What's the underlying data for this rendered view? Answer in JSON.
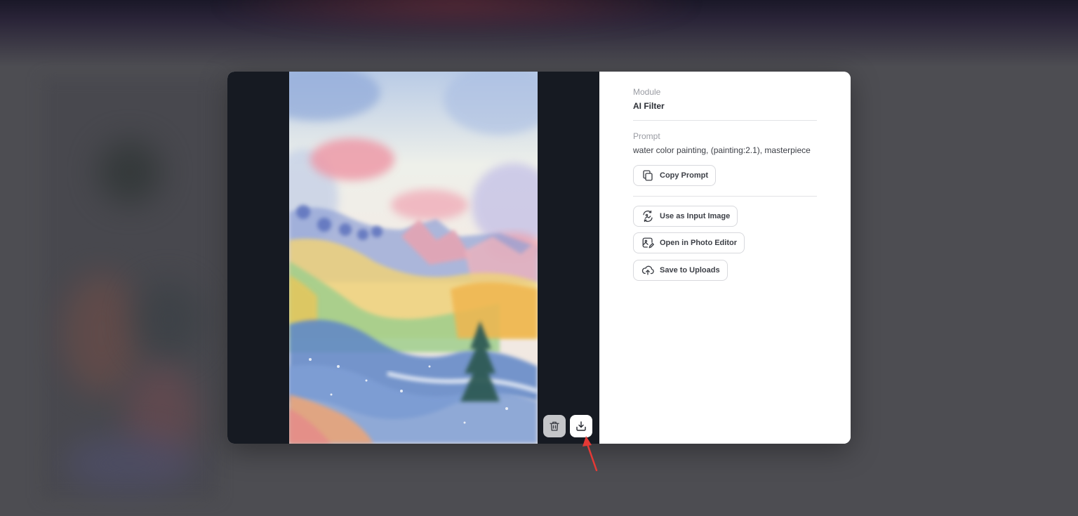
{
  "modal": {
    "module_label": "Module",
    "module_value": "AI Filter",
    "prompt_label": "Prompt",
    "prompt_value": "water color painting, (painting:2.1), masterpiece",
    "copy_prompt": "Copy Prompt",
    "use_as_input": "Use as Input Image",
    "open_editor": "Open in Photo Editor",
    "save_uploads": "Save to Uploads"
  },
  "icons": {
    "delete": "trash-icon",
    "download": "download-icon",
    "copy": "copy-icon",
    "use_input": "image-swap-icon",
    "editor": "image-edit-icon",
    "upload": "cloud-upload-icon"
  },
  "colors": {
    "preview_bg": "#161a22",
    "annotation_arrow": "#e53935"
  }
}
